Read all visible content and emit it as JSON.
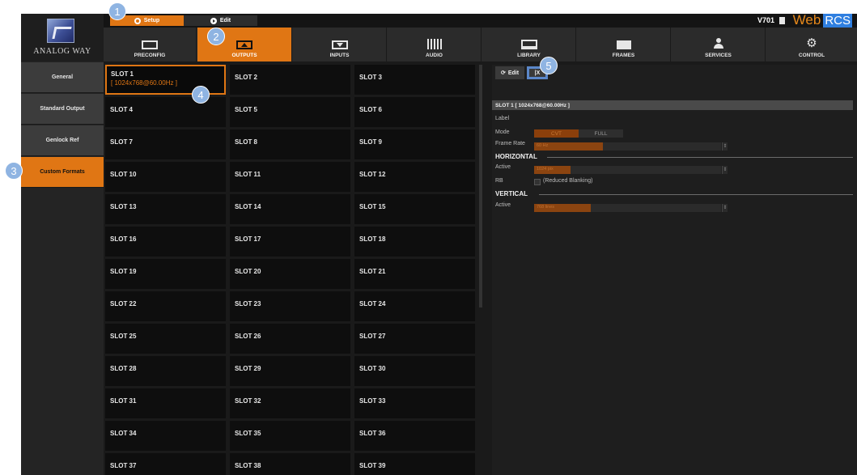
{
  "app": {
    "logo_text": "ANALOG WAY",
    "version": "V701",
    "brand_web": "Web",
    "brand_rcs": "RCS",
    "accent_color": "#e07614"
  },
  "mode_buttons": {
    "setup": "Setup",
    "edit": "Edit"
  },
  "tabs": [
    {
      "label": "PRECONFIG",
      "icon": "screen-icon"
    },
    {
      "label": "OUTPUTS",
      "icon": "output-screen-icon",
      "active": true
    },
    {
      "label": "INPUTS",
      "icon": "input-screen-icon"
    },
    {
      "label": "AUDIO",
      "icon": "audio-bars-icon"
    },
    {
      "label": "LIBRARY",
      "icon": "library-icon"
    },
    {
      "label": "FRAMES",
      "icon": "frames-icon"
    },
    {
      "label": "SERVICES",
      "icon": "person-icon"
    },
    {
      "label": "CONTROL",
      "icon": "gears-icon"
    }
  ],
  "left_menu": [
    {
      "label": "General"
    },
    {
      "label": "Standard Output"
    },
    {
      "label": "Genlock Ref"
    },
    {
      "label": "Custom Formats",
      "active": true
    }
  ],
  "slots": {
    "selected": {
      "name": "SLOT 1",
      "resolution": "[ 1024x768@60.00Hz ]"
    },
    "names": [
      "SLOT 2",
      "SLOT 3",
      "SLOT 4",
      "SLOT 5",
      "SLOT 6",
      "SLOT 7",
      "SLOT 8",
      "SLOT 9",
      "SLOT 10",
      "SLOT 11",
      "SLOT 12",
      "SLOT 13",
      "SLOT 14",
      "SLOT 15",
      "SLOT 16",
      "SLOT 17",
      "SLOT 18",
      "SLOT 19",
      "SLOT 20",
      "SLOT 21",
      "SLOT 22",
      "SLOT 23",
      "SLOT 24",
      "SLOT 25",
      "SLOT 26",
      "SLOT 27",
      "SLOT 28",
      "SLOT 29",
      "SLOT 30",
      "SLOT 31",
      "SLOT 32",
      "SLOT 33",
      "SLOT 34",
      "SLOT 35",
      "SLOT 36",
      "SLOT 37",
      "SLOT 38",
      "SLOT 39"
    ]
  },
  "panel": {
    "edit_label": "Edit",
    "clear_label": "|X",
    "header": "SLOT 1 [ 1024x768@60.00Hz ]",
    "label_field": "Label",
    "mode_label": "Mode",
    "mode_options": [
      "CVT",
      "FULL"
    ],
    "frame_rate_label": "Frame Rate",
    "frame_rate_value": "60 Hz",
    "horizontal_title": "HORIZONTAL",
    "h_active_label": "Active",
    "h_active_value": "1024 pix",
    "rb_label": "RB",
    "rb_text": "(Reduced Blanking)",
    "vertical_title": "VERTICAL",
    "v_active_label": "Active",
    "v_active_value": "768 lines"
  },
  "callouts": [
    "1",
    "2",
    "3",
    "4",
    "5"
  ]
}
